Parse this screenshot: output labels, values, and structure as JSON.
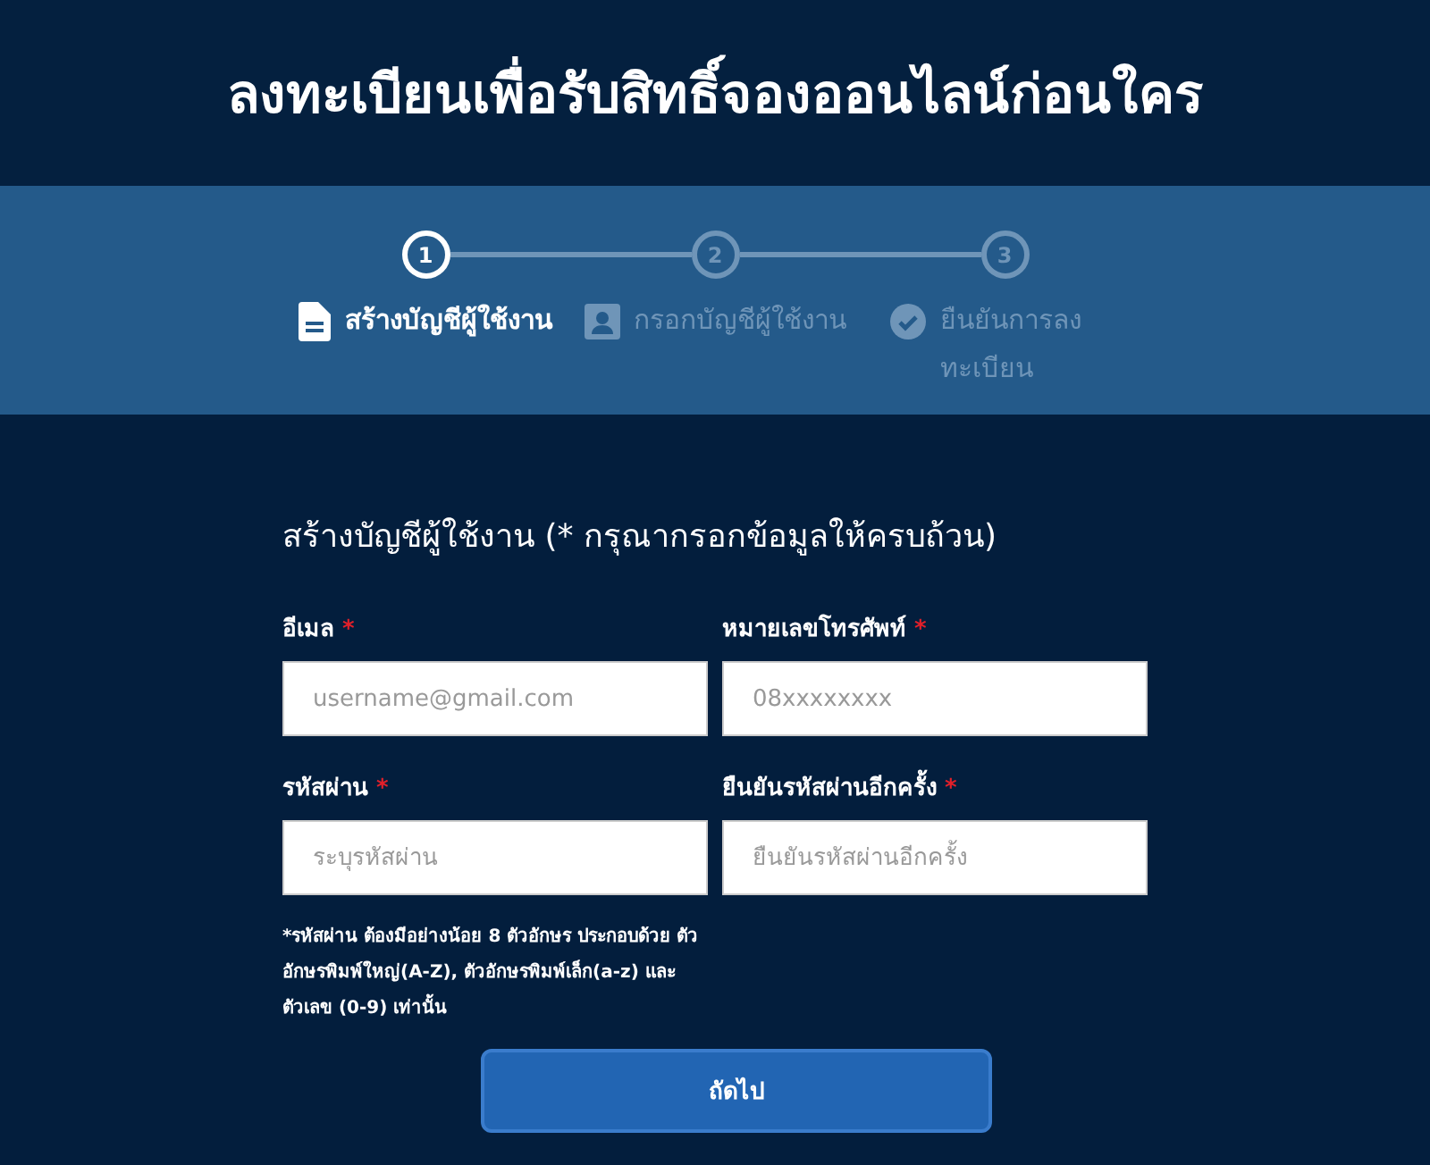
{
  "header": {
    "title": "ลงทะเบียนเพื่อรับสิทธิ์จองออนไลน์ก่อนใคร"
  },
  "steps": [
    {
      "number": "1",
      "label": "สร้างบัญชีผู้ใช้งาน",
      "kind": "document",
      "selected": true
    },
    {
      "number": "2",
      "label": "กรอกบัญชีผู้ใช้งาน",
      "kind": "person",
      "selected": false
    },
    {
      "number": "3",
      "label": "ยืนยันการลงทะเบียน",
      "kind": "check",
      "selected": false
    }
  ],
  "form": {
    "title": "สร้างบัญชีผู้ใช้งาน (* กรุณากรอกข้อมูลให้ครบถ้วน)",
    "fields": [
      {
        "label": "อีเมล",
        "required_mark": "*",
        "placeholder": "username@gmail.com"
      },
      {
        "label": "หมายเลขโทรศัพท์",
        "required_mark": "*",
        "placeholder": "08xxxxxxxx"
      },
      {
        "label": "รหัสผ่าน",
        "required_mark": "*",
        "placeholder": "ระบุรหัสผ่าน"
      },
      {
        "label": "ยืนยันรหัสผ่านอีกครั้ง",
        "required_mark": "*",
        "placeholder": "ยืนยันรหัสผ่านอีกครั้ง"
      }
    ],
    "note": "*รหัสผ่าน ต้องมีอย่างน้อย 8 ตัวอักษร ประกอบด้วย ตัวอักษรพิมพ์ใหญ่(A-Z), ตัวอักษรพิมพ์เล็ก(a-z) และ ตัวเลข (0-9) เท่านั้น",
    "submit": "ถัดไป"
  }
}
